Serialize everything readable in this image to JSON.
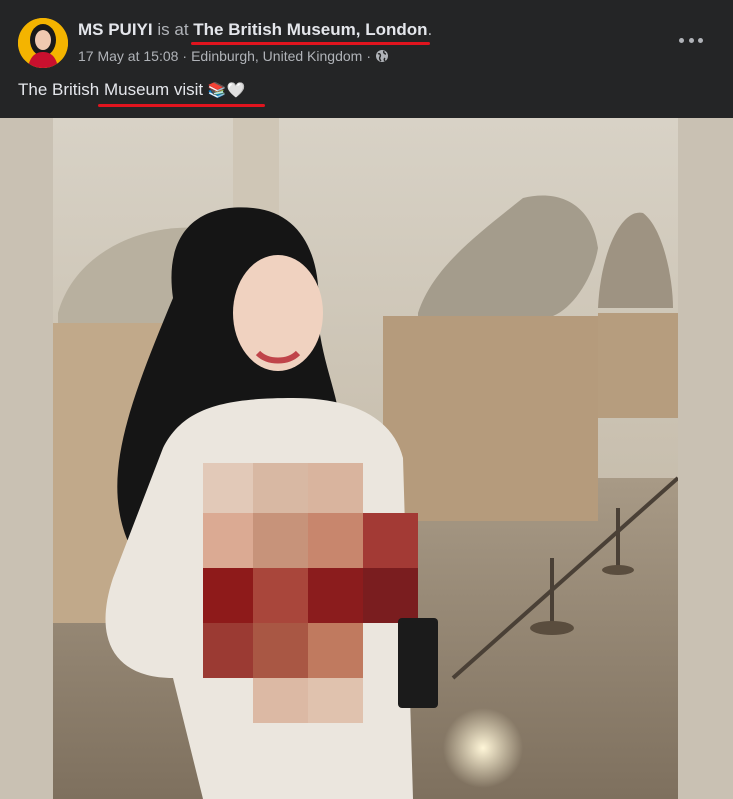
{
  "post": {
    "author": "MS PUIYI",
    "is_at": "is at",
    "location": "The British Museum, London",
    "period": ".",
    "date": "17 May at 15:08",
    "separator": "·",
    "place": "Edinburgh, United Kingdom",
    "privacy_icon": "globe-icon",
    "more_icon": "more-options-icon",
    "caption": "The British Museum visit",
    "caption_emojis": "📚🤍"
  },
  "colors": {
    "background": "#242526",
    "primary_text": "#e4e6eb",
    "secondary_text": "#b0b3b8",
    "annotation_red": "#e0141e"
  },
  "photo": {
    "description": "Woman posing in a museum gallery with classical marble sculptures; chest area pixelated/censored"
  }
}
